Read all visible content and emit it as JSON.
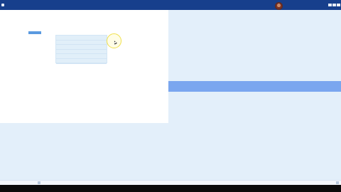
{
  "window": {
    "title": ""
  },
  "document": {
    "selected_text": "",
    "table_rows": [
      "",
      "",
      "",
      "",
      "",
      ""
    ]
  },
  "colors": {
    "titlebar": "#173f8c",
    "workspace": "#e3effa",
    "document": "#ffffff",
    "selection": "#5a9ae0",
    "highlight_band": "#7aa6ef",
    "cursor_ring": "#f0e04a"
  },
  "icons": {
    "app": "app-icon",
    "user": "avatar",
    "minimize": "minimize-icon",
    "maximize": "maximize-icon",
    "close": "close-icon",
    "pointer": "mouse-pointer-icon"
  }
}
